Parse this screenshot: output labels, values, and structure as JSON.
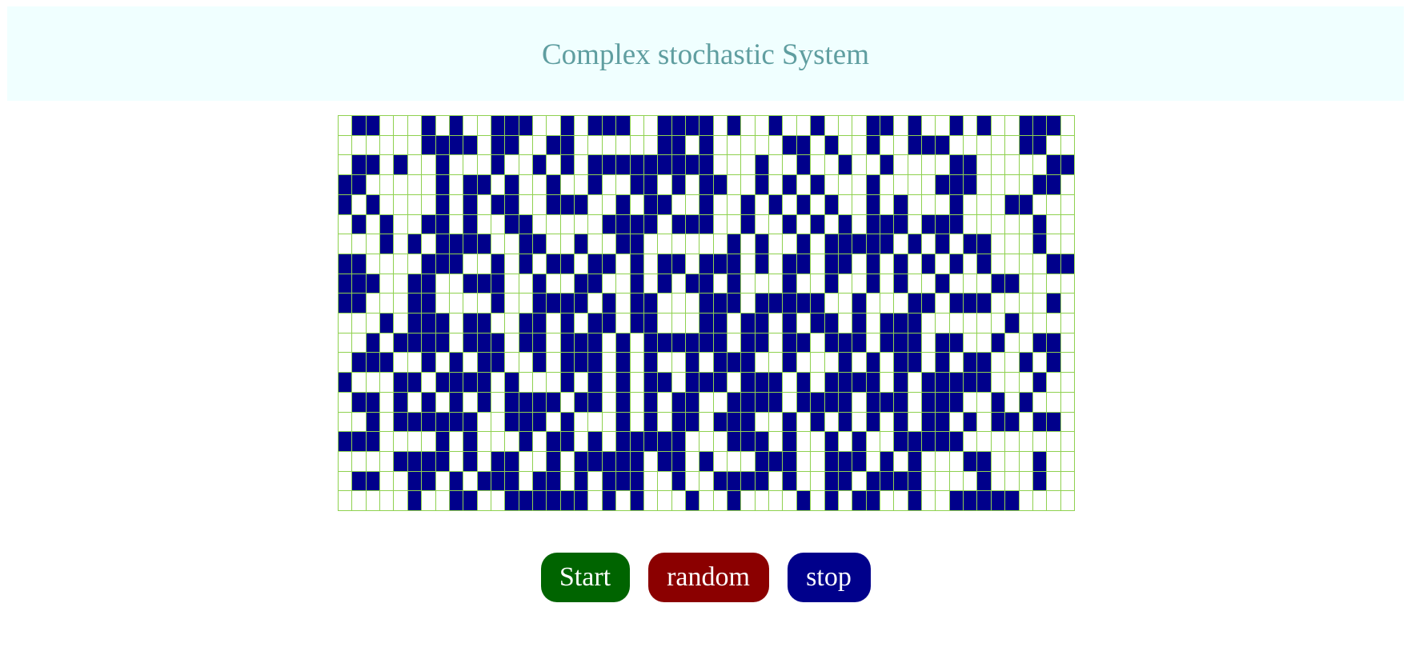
{
  "header": {
    "title": "Complex stochastic System"
  },
  "grid": {
    "rows": 20,
    "cols": 53,
    "on_color": "#00008b",
    "off_color": "#ffffff",
    "line_color": "#8fd14f",
    "cells": [
      "01100010100111001011100111101001001000110100101001110001",
      "00000011110110011000000110100000110100100111000001100000",
      "01101001000100101011111111100010010010010000110000011000",
      "11000001011010010010011010110010101000100001110000110000",
      "10100001010110011100101100100101010100101000100011000000",
      "01010011010011000001111011100100101010111011100000100000",
      "00010101111001100100110000001010010111110101011000100000",
      "11000011100101011011010110111010110110101010101000011000",
      "11100110011100100110010101101000100100101001000110000000",
      "11000110000100111101011000111011111001000110111000010000",
      "00010111011001101011011000110110101101011100000010000000",
      "00101111011101101110101111110110110111011101100100110000",
      "01110010101100101110101001011100100010101101011001010000",
      "10001101111010001010101101110111010111101011111000100000",
      "01101010101011110110101011001111011110111011100101000000",
      "00101111110011101000101011011100101010101011010110110000",
      "11100001010001011010111110001110100101001111100000000000",
      "00001111010110010111110110100011100111010100011000100000",
      "01100110101110110101110010011110100110111100001000100000",
      "00000100110011111101010001001000010101100100111110000000"
    ]
  },
  "controls": {
    "start_label": "Start",
    "random_label": "random",
    "stop_label": "stop",
    "start_color": "#006400",
    "random_color": "#8b0000",
    "stop_color": "#00008b"
  }
}
